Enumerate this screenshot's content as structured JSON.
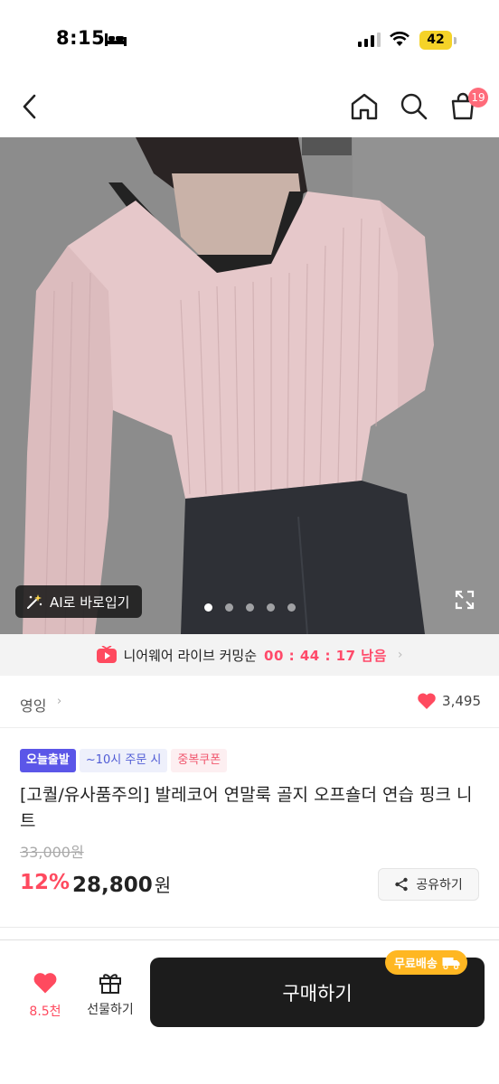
{
  "status": {
    "time": "8:15",
    "battery": "42"
  },
  "nav": {
    "cart_badge": "19"
  },
  "hero": {
    "ai_button": "AI로 바로입기",
    "image_count": 5,
    "active_index": 0
  },
  "live": {
    "text": "니어웨어 라이브 커밍순",
    "countdown": "00 : 44 : 17 남음"
  },
  "seller": {
    "name": "영잉",
    "likes": "3,495"
  },
  "tags": [
    "오늘출발",
    "~10시 주문 시",
    "중복쿠폰"
  ],
  "product": {
    "title": "[고퀄/유사품주의] 발레코어 연말룩 골지 오프숄더 연습 핑크 니트",
    "original_price": "33,000원",
    "discount": "12%",
    "price": "28,800",
    "currency": "원",
    "share_label": "공유하기"
  },
  "bottom": {
    "wish_count": "8.5천",
    "gift_label": "선물하기",
    "buy_label": "구매하기",
    "free_shipping": "무료배송"
  },
  "colors": {
    "accent": "#ff4a5f",
    "buy": "#1c1c1c",
    "free_ship": "#ffb722",
    "today_tag": "#5b56e8"
  }
}
